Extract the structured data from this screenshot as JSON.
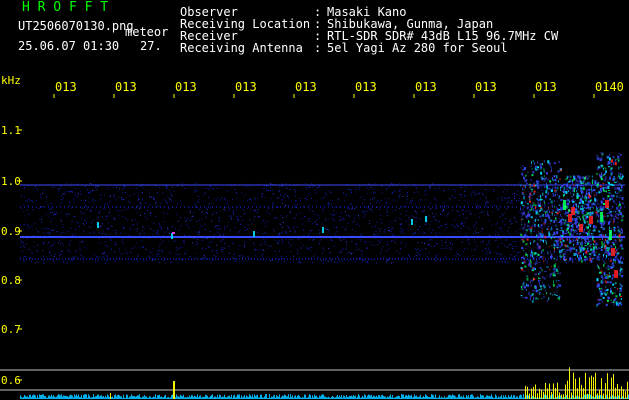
{
  "brand": {
    "title": "H R O F F T",
    "title_color": "#00ff00"
  },
  "file": {
    "name": "UT2506070130.png",
    "tag": "meteor",
    "date_time": "25.06.07 01:30",
    "value": "27."
  },
  "info": {
    "rows": [
      {
        "label": "Observer",
        "sep": ":",
        "value": "Masaki Kano"
      },
      {
        "label": "Receiving Location",
        "sep": ":",
        "value": "Shibukawa, Gunma, Japan"
      },
      {
        "label": "Receiver",
        "sep": ":",
        "value": "RTL-SDR SDR# 43dB L15 96.7MHz CW"
      },
      {
        "label": "Receiving Antenna",
        "sep": ":",
        "value": "5el Yagi Az 280 for Seoul"
      }
    ]
  },
  "time_axis": {
    "labels": [
      "013",
      "013",
      "013",
      "013",
      "013",
      "013",
      "013",
      "013",
      "013",
      "0140"
    ],
    "color": "#ffff00"
  },
  "freq_axis": {
    "unit": "kHz",
    "labels": [
      "1.1",
      "1.0",
      "0.9",
      "0.8",
      "0.7",
      "0.6"
    ],
    "color": "#ffff00"
  },
  "colors": {
    "background": "#000000",
    "noise_blue": "#1a2cff",
    "band_blue": "#3a4aff",
    "meteor_cyan": "#00e0ff",
    "meteor_green": "#00ff60",
    "meteor_red": "#ff2020",
    "meteor_magenta": "#ff40ff",
    "strip_yellow": "#ffff00",
    "strip_cyan": "#00c0ff",
    "reference_line": "#c0c0c0"
  }
}
